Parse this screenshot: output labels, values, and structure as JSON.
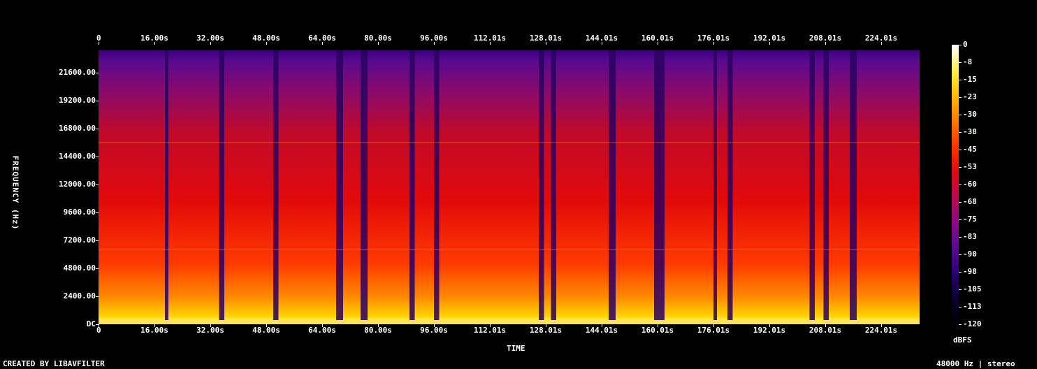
{
  "chart_data": {
    "type": "heatmap",
    "xlabel": "TIME",
    "ylabel": "FREQUENCY (Hz)",
    "x_ticks": [
      "0",
      "16.00s",
      "32.00s",
      "48.00s",
      "64.00s",
      "80.00s",
      "96.00s",
      "112.01s",
      "128.01s",
      "144.01s",
      "160.01s",
      "176.01s",
      "192.01s",
      "208.01s",
      "224.01s"
    ],
    "y_ticks": [
      "DC",
      "2400.00",
      "4800.00",
      "7200.00",
      "9600.00",
      "12000.00",
      "14400.00",
      "16800.00",
      "19200.00",
      "21600.00"
    ],
    "colorbar_ticks": [
      "0",
      "-8",
      "-15",
      "-23",
      "-30",
      "-38",
      "-45",
      "-53",
      "-60",
      "-68",
      "-75",
      "-83",
      "-90",
      "-98",
      "-105",
      "-113",
      "-120"
    ],
    "colorbar_label": "dBFS",
    "xlim": [
      0,
      240
    ],
    "ylim": [
      0,
      24000
    ],
    "zlim": [
      -120,
      0
    ],
    "signal_end_s": 235,
    "quiet_gaps_s": [
      [
        19,
        20
      ],
      [
        34.5,
        36
      ],
      [
        50,
        51.5
      ],
      [
        68,
        70
      ],
      [
        75,
        77
      ],
      [
        89,
        90.5
      ],
      [
        96,
        97.5
      ],
      [
        126,
        127.5
      ],
      [
        129.5,
        131
      ],
      [
        146,
        148
      ],
      [
        159,
        162
      ],
      [
        176,
        177
      ],
      [
        180,
        181.5
      ],
      [
        203.5,
        205
      ],
      [
        207.5,
        209
      ],
      [
        215,
        217
      ]
    ],
    "colorscale": [
      "#000000",
      "#0b0030",
      "#2a0070",
      "#5a0a90",
      "#8a0a8a",
      "#b80a50",
      "#e00a10",
      "#ff3300",
      "#ff7a00",
      "#ffbd00",
      "#ffee55",
      "#ffffff"
    ]
  },
  "footer": {
    "left": "CREATED BY LIBAVFILTER",
    "right": "48000 Hz | stereo"
  }
}
